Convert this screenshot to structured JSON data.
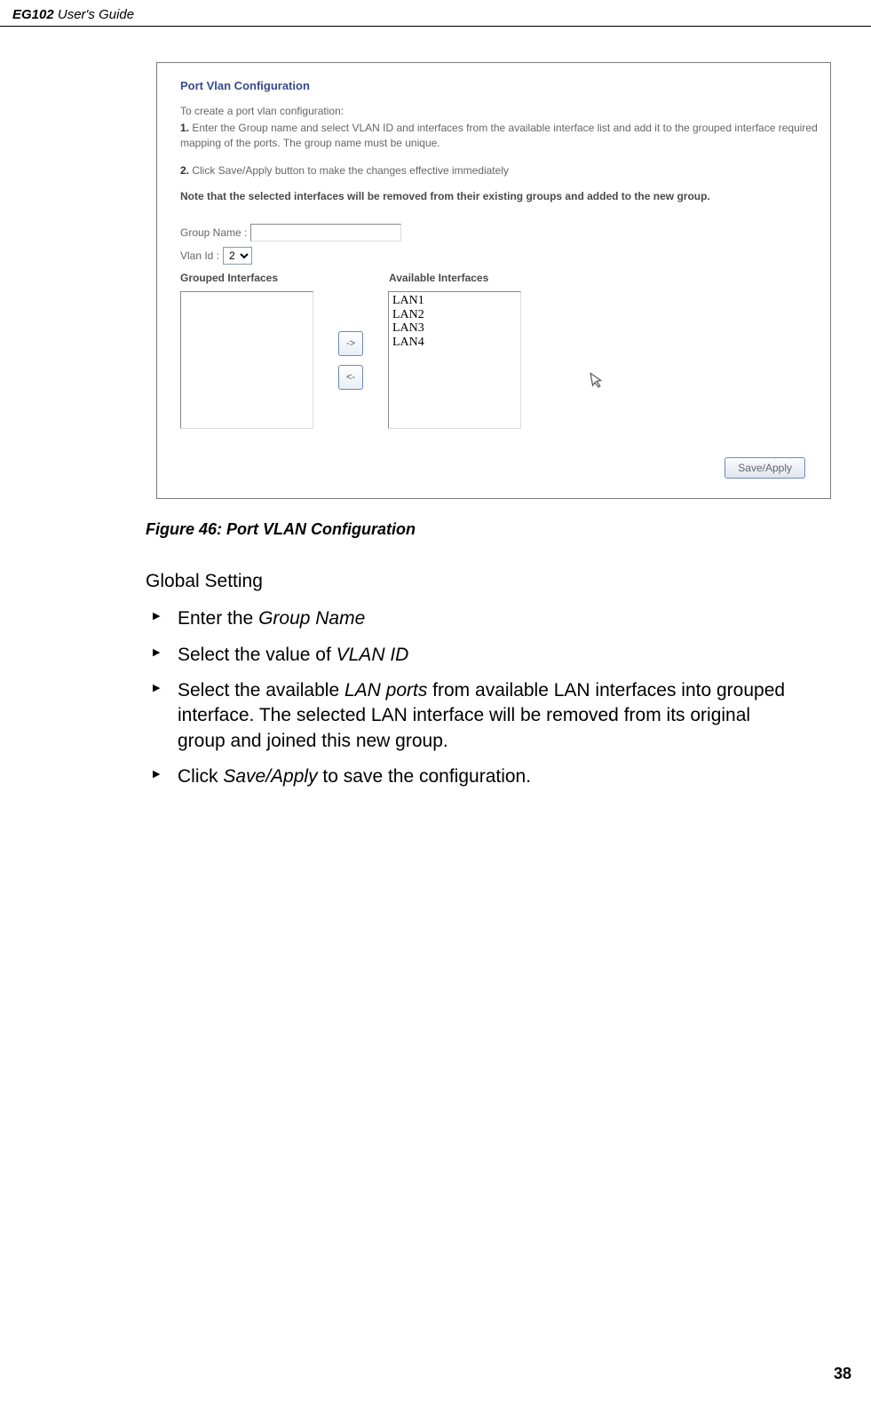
{
  "header": {
    "product": "EG102",
    "suffix": " User's Guide"
  },
  "panel": {
    "title": "Port Vlan Configuration",
    "intro": "To create a port vlan configuration:",
    "step1_num": "1.",
    "step1_text": " Enter the Group name and select VLAN ID and interfaces from the available interface list and add it to the grouped interface required mapping of the ports. The group name must be unique.",
    "step2_num": "2.",
    "step2_text": " Click Save/Apply button to make the changes effective immediately",
    "note": "Note that the selected interfaces will be removed from their existing groups and added to the new group.",
    "group_label": "Group Name :",
    "vlan_label": "Vlan Id :",
    "vlan_selected": "2",
    "grouped_header": "Grouped Interfaces",
    "available_header": "Available Interfaces",
    "available_items": [
      "LAN1",
      "LAN2",
      "LAN3",
      "LAN4"
    ],
    "arrow_right": "->",
    "arrow_left": "<-",
    "save_label": "Save/Apply"
  },
  "figure_caption": "Figure 46: Port VLAN Configuration",
  "section_label": "Global Setting",
  "bullets": [
    {
      "pre": "Enter the ",
      "ital": "Group Name",
      "post": ""
    },
    {
      "pre": "Select the value of ",
      "ital": "VLAN ID",
      "post": ""
    },
    {
      "pre": "Select the available ",
      "ital": "LAN ports",
      "post": " from available LAN interfaces into grouped interface. The selected LAN interface will be removed from its original group and joined this new group."
    },
    {
      "pre": "Click ",
      "ital": "Save/Apply",
      "post": " to save the configuration."
    }
  ],
  "page_num": "38"
}
